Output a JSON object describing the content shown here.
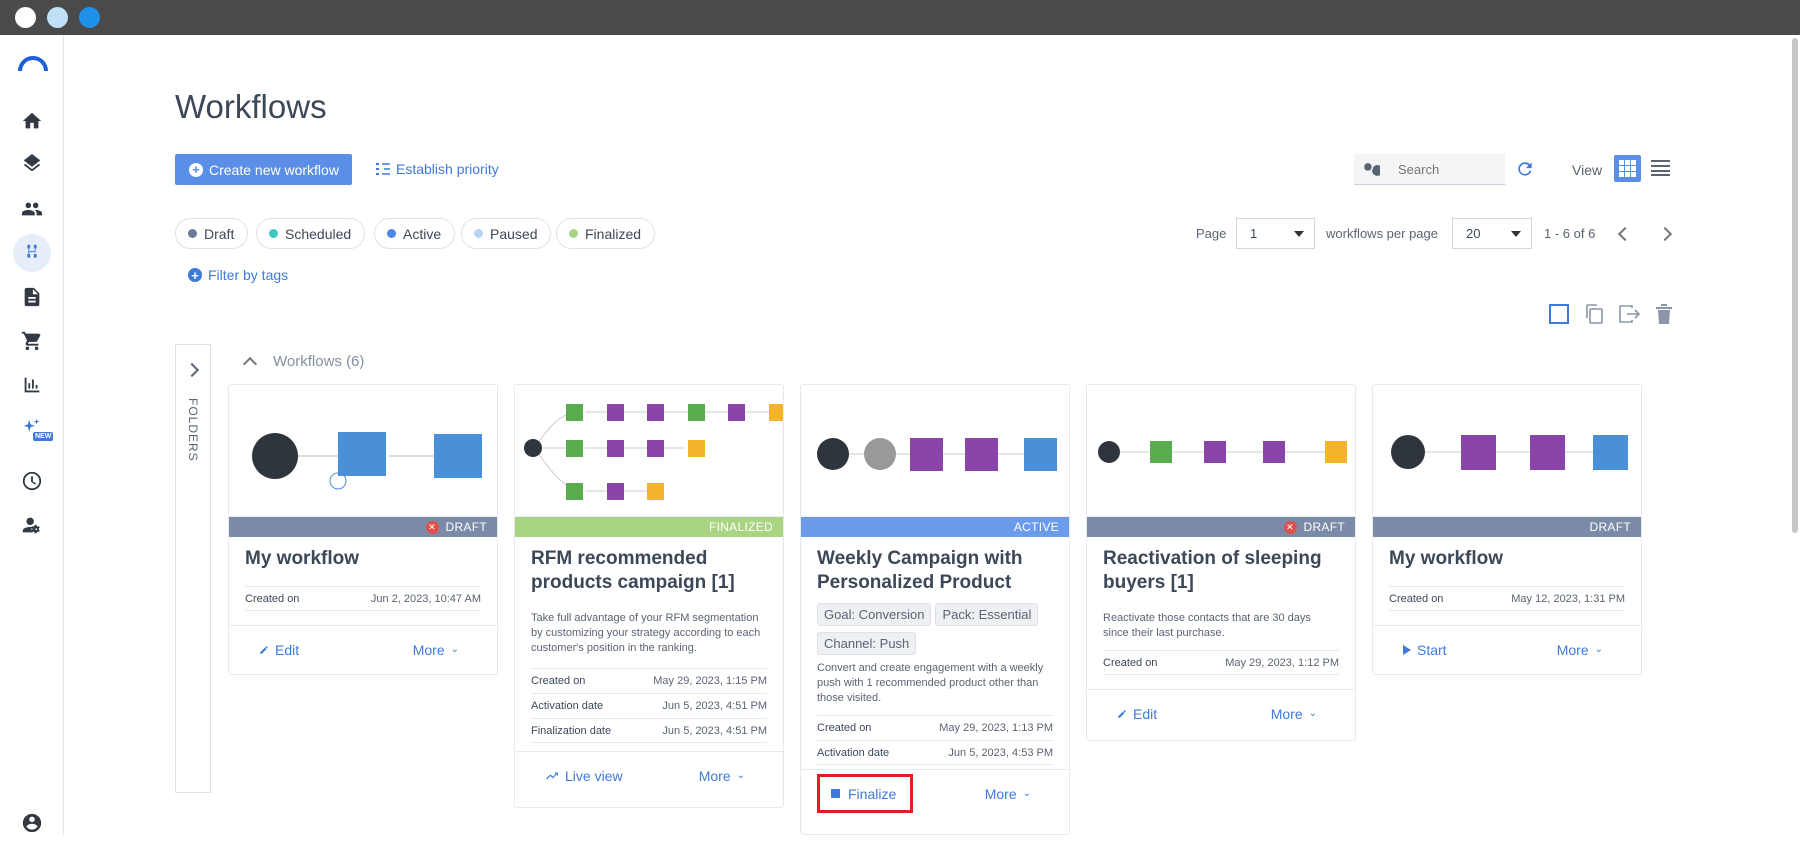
{
  "colors": {
    "accent": "#3e7bd8",
    "primary_btn": "#5b8ee6",
    "draft": "#7b8aa6",
    "finalized": "#a9d483",
    "active": "#6a9ceb",
    "paused": "#b8d4f0",
    "scheduled": "#3fc7c2",
    "highlight": "#e02020"
  },
  "window": {
    "buttons": [
      "close",
      "minimize",
      "maximize"
    ]
  },
  "sidebar": {
    "items": [
      "home-icon",
      "layers-icon",
      "contacts-icon",
      "workflows-icon",
      "documents-icon",
      "cart-icon",
      "reports-icon",
      "ai-new-icon",
      "dashboard-icon",
      "user-settings-icon",
      "account-icon"
    ],
    "new_badge": "NEW"
  },
  "page": {
    "title": "Workflows"
  },
  "toolbar": {
    "create_label": "Create new workflow",
    "priority_label": "Establish priority",
    "search_placeholder": "Search",
    "view_label": "View"
  },
  "filters": [
    {
      "label": "Draft",
      "color": "#6c7a98"
    },
    {
      "label": "Scheduled",
      "color": "#3fc7c2"
    },
    {
      "label": "Active",
      "color": "#4f86e6"
    },
    {
      "label": "Paused",
      "color": "#b8d4f0"
    },
    {
      "label": "Finalized",
      "color": "#a9d483"
    }
  ],
  "tags_filter": "Filter by tags",
  "pagination": {
    "page_label": "Page",
    "page": "1",
    "per_page_label": "workflows per page",
    "per_page": "20",
    "range": "1 - 6 of 6"
  },
  "folders": {
    "label": "FOLDERS"
  },
  "group": {
    "title": "Workflows (6)"
  },
  "cards": [
    {
      "title": "My workflow",
      "status": "DRAFT",
      "status_color": "#7b8aa6",
      "error": true,
      "meta": [
        {
          "label": "Created on",
          "value": "Jun 2, 2023, 10:47 AM"
        }
      ],
      "action": "Edit",
      "more": "More"
    },
    {
      "title": "RFM recommended products campaign [1]",
      "status": "FINALIZED",
      "status_color": "#a9d483",
      "error": false,
      "description": "Take full advantage of your RFM segmentation by customizing your strategy according to each customer's position in the ranking.",
      "meta": [
        {
          "label": "Created on",
          "value": "May 29, 2023, 1:15 PM"
        },
        {
          "label": "Activation date",
          "value": "Jun 5, 2023, 4:51 PM"
        },
        {
          "label": "Finalization date",
          "value": "Jun 5, 2023, 4:51 PM"
        }
      ],
      "action": "Live view",
      "more": "More"
    },
    {
      "title": "Weekly Campaign with Personalized Product",
      "status": "ACTIVE",
      "status_color": "#6a9ceb",
      "error": false,
      "tags": [
        "Goal: Conversion",
        "Pack: Essential",
        "Channel: Push"
      ],
      "description": "Convert and create engagement with a weekly push with 1 recommended product other than those visited.",
      "meta": [
        {
          "label": "Created on",
          "value": "May 29, 2023, 1:13 PM"
        },
        {
          "label": "Activation date",
          "value": "Jun 5, 2023, 4:53 PM"
        }
      ],
      "action": "Finalize",
      "more": "More"
    },
    {
      "title": "Reactivation of sleeping buyers [1]",
      "status": "DRAFT",
      "status_color": "#7b8aa6",
      "error": true,
      "description": "Reactivate those contacts that are 30 days since their last purchase.",
      "meta": [
        {
          "label": "Created on",
          "value": "May 29, 2023, 1:12 PM"
        }
      ],
      "action": "Edit",
      "more": "More"
    },
    {
      "title": "My workflow",
      "status": "DRAFT",
      "status_color": "#7b8aa6",
      "error": false,
      "meta": [
        {
          "label": "Created on",
          "value": "May 12, 2023, 1:31 PM"
        }
      ],
      "action": "Start",
      "more": "More"
    }
  ]
}
